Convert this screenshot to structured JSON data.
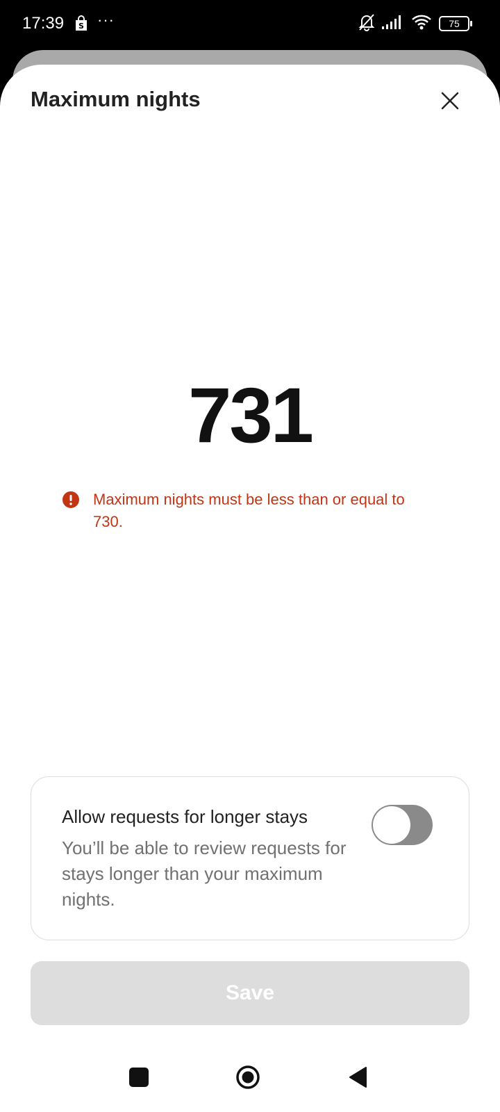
{
  "status_bar": {
    "time": "17:39",
    "shop_icon": "shopping-bag-icon",
    "more_indicator": "···",
    "battery_level": "75",
    "icons": [
      "bell-off-icon",
      "signal-icon",
      "wifi-icon",
      "battery-icon"
    ]
  },
  "sheet": {
    "title": "Maximum nights",
    "close_icon": "close-icon"
  },
  "value": {
    "nights": "731"
  },
  "error": {
    "icon": "error-icon",
    "message": "Maximum nights must be less than or equal to 730.",
    "color": "#c13515"
  },
  "toggle_card": {
    "title": "Allow requests for longer stays",
    "description": "You’ll be able to review requests for stays longer than your maximum nights.",
    "enabled": false
  },
  "save": {
    "label": "Save",
    "disabled": true
  },
  "nav": {
    "icons": [
      "recents-icon",
      "home-icon",
      "back-icon"
    ]
  }
}
